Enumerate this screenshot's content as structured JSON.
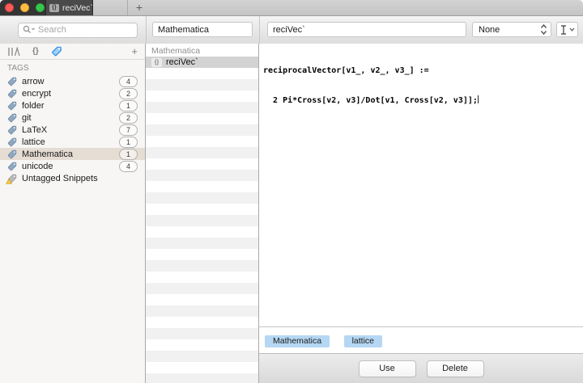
{
  "window": {
    "tab_title": "reciVec`",
    "new_tab_label": "+"
  },
  "icons": {
    "braces_glyph": "{}",
    "plus_glyph": "+"
  },
  "toolbar": {
    "search_placeholder": "Search",
    "filter_value": "Mathematica",
    "snippet_name_value": "reciVec`",
    "syntax_value": "None"
  },
  "sidebar": {
    "section_title": "TAGS",
    "tags": [
      {
        "label": "arrow",
        "count": "4"
      },
      {
        "label": "encrypt",
        "count": "2"
      },
      {
        "label": "folder",
        "count": "1"
      },
      {
        "label": "git",
        "count": "2"
      },
      {
        "label": "LaTeX",
        "count": "7"
      },
      {
        "label": "lattice",
        "count": "1"
      },
      {
        "label": "Mathematica",
        "count": "1"
      },
      {
        "label": "unicode",
        "count": "4"
      },
      {
        "label": "Untagged Snippets",
        "count": ""
      }
    ]
  },
  "snippet_list": {
    "group_header": "Mathematica",
    "items": [
      {
        "title": "reciVec`"
      }
    ]
  },
  "editor": {
    "code_lines": [
      "reciprocalVector[v1_, v2_, v3_] :=",
      "  2 Pi*Cross[v2, v3]/Dot[v1, Cross[v2, v3]];"
    ],
    "tags": [
      "Mathematica",
      "lattice"
    ]
  },
  "footer": {
    "use_label": "Use",
    "delete_label": "Delete"
  },
  "colors": {
    "tab_dark": "#4a4a4a",
    "selected_tag_row": "#e5dcd3",
    "selection_gray": "#d3d3d3",
    "chip_blue": "#b5d7f3",
    "accent_blue": "#3e9ef5"
  }
}
